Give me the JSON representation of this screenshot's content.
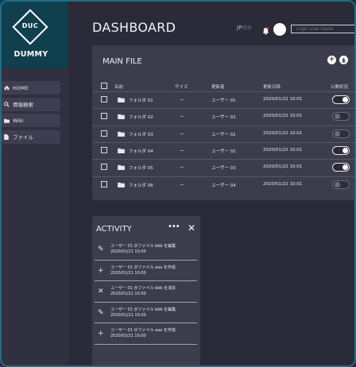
{
  "logo": {
    "mark": "DUC",
    "text": "DUMMY"
  },
  "sidebar": {
    "items": [
      {
        "label": "HOME",
        "icon": "home-icon"
      },
      {
        "label": "情報検索",
        "icon": "search-icon"
      },
      {
        "label": "Wiki",
        "icon": "folder-icon"
      },
      {
        "label": "ファイル",
        "icon": "file-icon"
      }
    ]
  },
  "header": {
    "title": "DASHBOARD",
    "lang_active": "JP",
    "lang_sep": "/",
    "lang_inactive": "EN",
    "login_placeholder": "Login User Name"
  },
  "main_file": {
    "title": "MAIN FILE",
    "add_icon": "+",
    "download_icon": "⬇",
    "columns": [
      "名前",
      "サイズ",
      "更新者",
      "更新日時",
      "公開状況"
    ],
    "rows": [
      {
        "name": "フォルダ 01",
        "size": "ー",
        "updater": "ユーザー 01",
        "updated": "2020/01/22 10:01",
        "public": true
      },
      {
        "name": "フォルダ 02",
        "size": "ー",
        "updater": "ユーザー 02",
        "updated": "2020/01/22 10:01",
        "public": false
      },
      {
        "name": "フォルダ 03",
        "size": "ー",
        "updater": "ユーザー 02",
        "updated": "2020/01/22 10:01",
        "public": false
      },
      {
        "name": "フォルダ 04",
        "size": "ー",
        "updater": "ユーザー 02",
        "updated": "2020/01/22 10:01",
        "public": true
      },
      {
        "name": "フォルダ 05",
        "size": "ー",
        "updater": "ユーザー 03",
        "updated": "2020/01/22 10:01",
        "public": true
      },
      {
        "name": "フォルダ 06",
        "size": "ー",
        "updater": "ユーザー 04",
        "updated": "2020/01/22 10:01",
        "public": false
      }
    ]
  },
  "activity": {
    "title": "ACTIVITY",
    "more_icon": "•••",
    "close_icon": "✕",
    "items": [
      {
        "icon": "✎",
        "text": "ユーザー 01 がファイル bbb を編集",
        "time": "2020/01/21 10:00"
      },
      {
        "icon": "+",
        "text": "ユーザー 01 がファイル aaa を作成",
        "time": "2020/01/21 10:00"
      },
      {
        "icon": "✕",
        "text": "ユーザー 01 がファイル bbb を消去",
        "time": "2020/01/21 10:00"
      },
      {
        "icon": "✎",
        "text": "ユーザー 01 がファイル bbb を編集",
        "time": "2020/01/21 10:00"
      },
      {
        "icon": "+",
        "text": "ユーザー 01 がファイル aaa を作成",
        "time": "2020/01/21 10:00"
      }
    ]
  }
}
